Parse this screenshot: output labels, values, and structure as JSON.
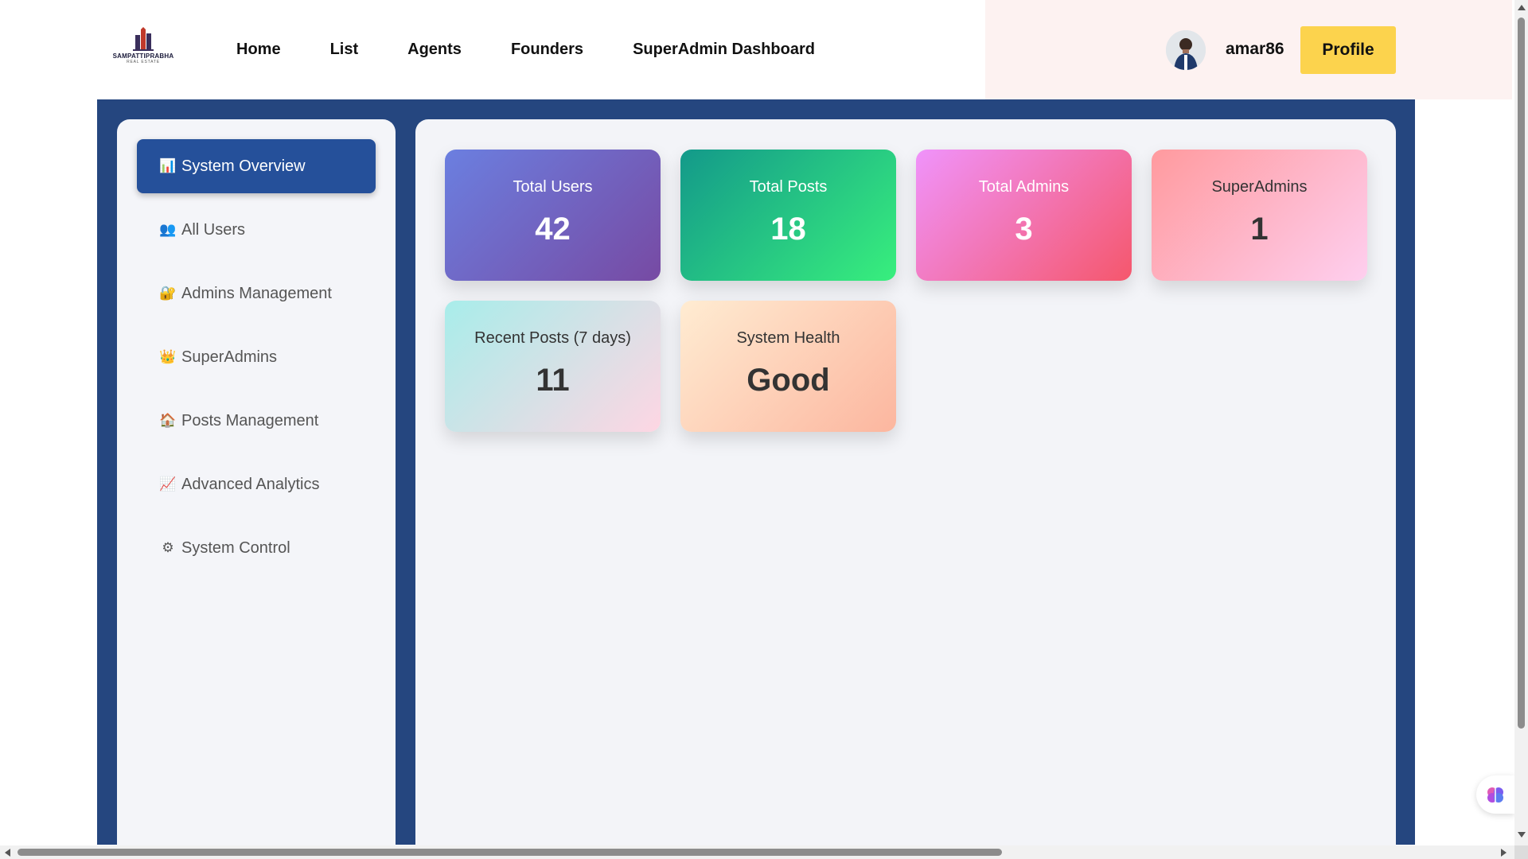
{
  "brand": {
    "name": "SAMPATTIPRABHA",
    "tagline": "REAL ESTATE"
  },
  "nav": {
    "links": [
      "Home",
      "List",
      "Agents",
      "Founders",
      "SuperAdmin Dashboard"
    ],
    "username": "amar86",
    "profile_label": "Profile"
  },
  "sidebar": {
    "items": [
      {
        "label": "System Overview",
        "icon": "bar-chart-icon",
        "glyph": "📊",
        "active": true
      },
      {
        "label": "All Users",
        "icon": "users-icon",
        "glyph": "👥",
        "active": false
      },
      {
        "label": "Admins Management",
        "icon": "lock-icon",
        "glyph": "🔐",
        "active": false
      },
      {
        "label": "SuperAdmins",
        "icon": "crown-icon",
        "glyph": "👑",
        "active": false
      },
      {
        "label": "Posts Management",
        "icon": "house-icon",
        "glyph": "🏠",
        "active": false
      },
      {
        "label": "Advanced Analytics",
        "icon": "trending-chart-icon",
        "glyph": "📈",
        "active": false
      },
      {
        "label": "System Control",
        "icon": "gear-icon",
        "glyph": "⚙",
        "active": false
      }
    ]
  },
  "stats": [
    {
      "label": "Total Users",
      "value": "42"
    },
    {
      "label": "Total Posts",
      "value": "18"
    },
    {
      "label": "Total Admins",
      "value": "3"
    },
    {
      "label": "SuperAdmins",
      "value": "1"
    },
    {
      "label": "Recent Posts (7 days)",
      "value": "11"
    },
    {
      "label": "System Health",
      "value": "Good"
    }
  ],
  "colors": {
    "nav_bg": "#ffffff",
    "nav_right_bg": "#fdf2f1",
    "main_bg": "#25467f",
    "active_item": "#25509a",
    "profile_button": "#fcd34d"
  },
  "floating_button": {
    "icon": "brain-icon"
  }
}
